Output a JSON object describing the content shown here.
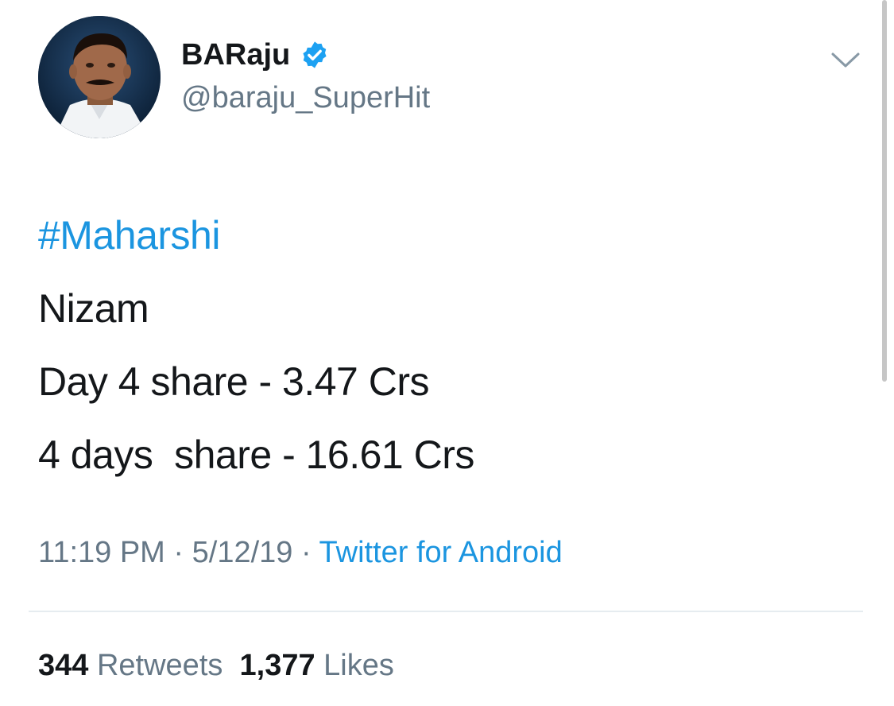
{
  "tweet": {
    "author": {
      "display_name": "BARaju",
      "handle": "@baraju_SuperHit",
      "verified": true,
      "avatar_icon": "profile-photo"
    },
    "lines": [
      "#Maharshi",
      "Nizam",
      "Day 4 share - 3.47 Crs",
      "4 days  share - 16.61 Crs"
    ],
    "time": "11:19 PM",
    "separator": " · ",
    "date": "5/12/19",
    "source": "Twitter for Android",
    "stats": {
      "retweets_count": "344",
      "retweets_label": "Retweets",
      "likes_count": "1,377",
      "likes_label": "Likes"
    }
  },
  "colors": {
    "link": "#1b95e0",
    "text": "#14171a",
    "secondary": "#657786",
    "verified_badge": "#1da1f2",
    "divider": "#e6ecf0"
  },
  "icons": {
    "verified": "verified-badge-icon",
    "menu": "chevron-down-icon"
  }
}
